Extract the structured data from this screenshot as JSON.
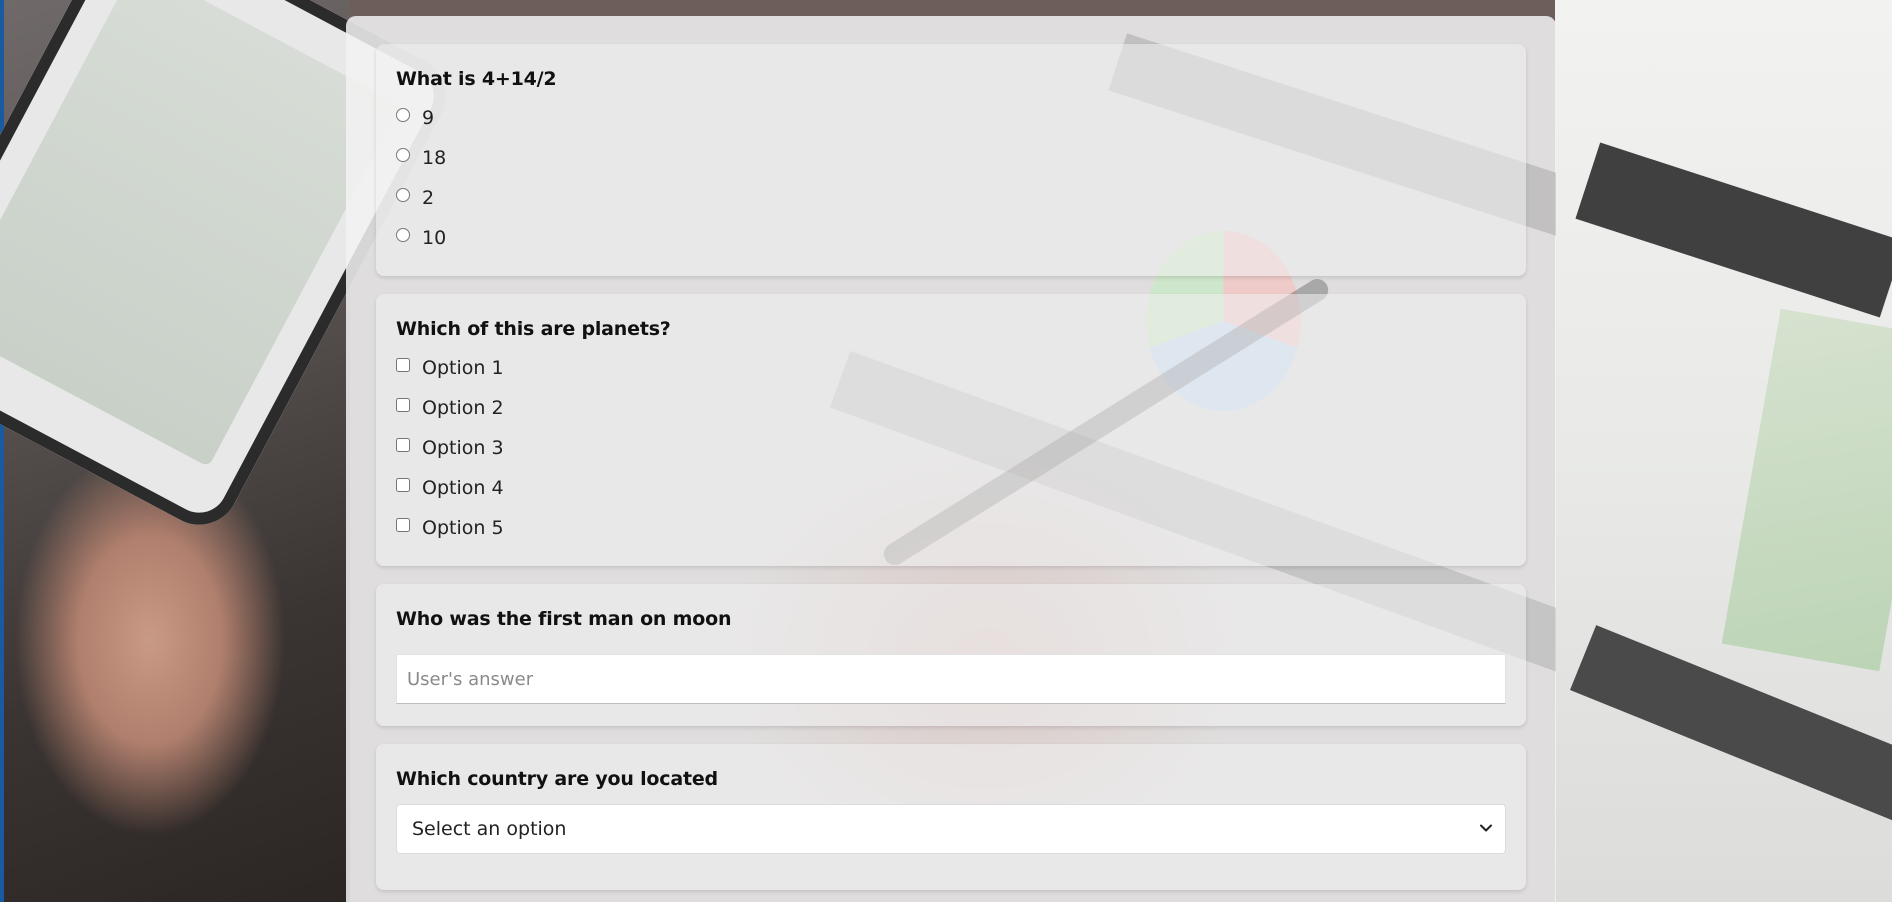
{
  "questions": [
    {
      "title": "What is 4+14/2",
      "type": "radio",
      "options": [
        "9",
        "18",
        "2",
        "10"
      ]
    },
    {
      "title": "Which of this are planets?",
      "type": "checkbox",
      "options": [
        "Option 1",
        "Option 2",
        "Option 3",
        "Option 4",
        "Option 5"
      ]
    },
    {
      "title": "Who was the first man on moon",
      "type": "text",
      "placeholder": "User's answer",
      "value": ""
    },
    {
      "title": "Which country are you located",
      "type": "select",
      "selected": "Select an option"
    }
  ]
}
